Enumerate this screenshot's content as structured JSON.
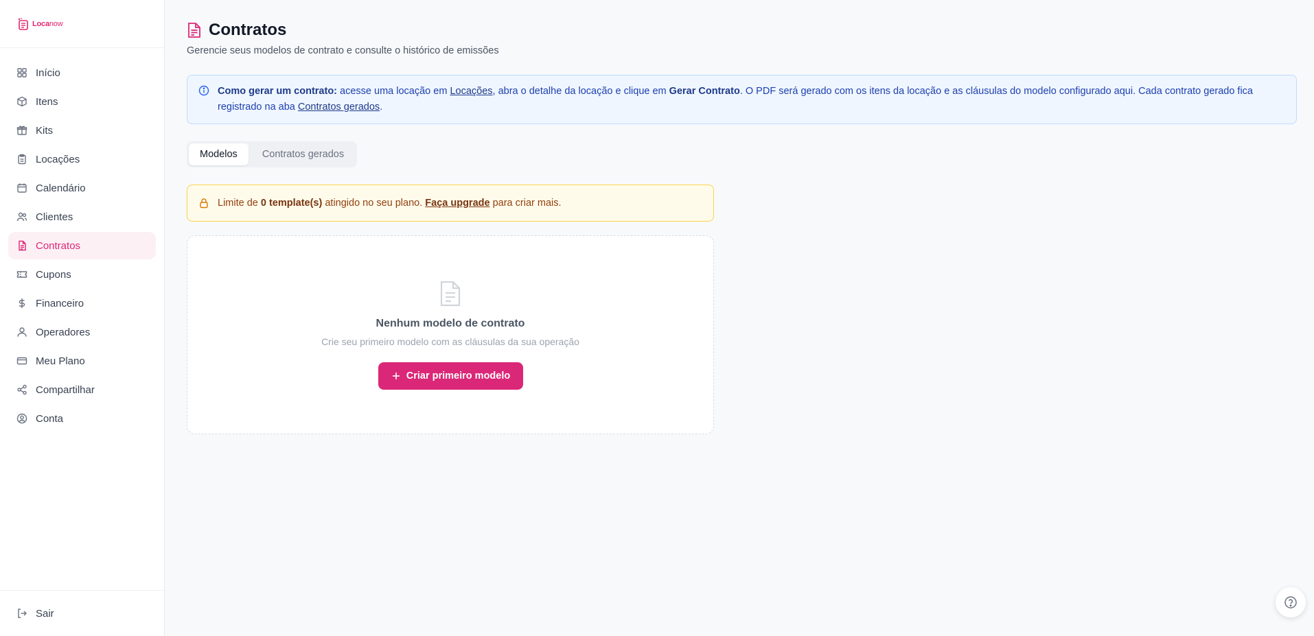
{
  "brand": {
    "name_part1": "Loca",
    "name_part2": "now"
  },
  "sidebar": {
    "items": [
      {
        "label": "Início",
        "icon": "dashboard-icon"
      },
      {
        "label": "Itens",
        "icon": "box-icon"
      },
      {
        "label": "Kits",
        "icon": "gift-icon"
      },
      {
        "label": "Locações",
        "icon": "clipboard-icon"
      },
      {
        "label": "Calendário",
        "icon": "calendar-icon"
      },
      {
        "label": "Clientes",
        "icon": "users-icon"
      },
      {
        "label": "Contratos",
        "icon": "file-text-icon",
        "active": true
      },
      {
        "label": "Cupons",
        "icon": "ticket-icon"
      },
      {
        "label": "Financeiro",
        "icon": "dollar-icon"
      },
      {
        "label": "Operadores",
        "icon": "user-icon"
      },
      {
        "label": "Meu Plano",
        "icon": "credit-card-icon"
      },
      {
        "label": "Compartilhar",
        "icon": "share-icon"
      },
      {
        "label": "Conta",
        "icon": "user-circle-icon"
      }
    ],
    "logout_label": "Sair"
  },
  "header": {
    "title": "Contratos",
    "subtitle": "Gerencie seus modelos de contrato e consulte o histórico de emissões"
  },
  "info": {
    "bold_lead": "Como gerar um contrato:",
    "text1": " acesse uma locação em ",
    "link1": "Locações",
    "text2": ", abra o detalhe da locação e clique em ",
    "bold2": "Gerar Contrato",
    "text3": ". O PDF será gerado com os itens da locação e as cláusulas do modelo configurado aqui. Cada contrato gerado fica registrado na aba ",
    "link2": "Contratos gerados",
    "text4": "."
  },
  "tabs": [
    {
      "label": "Modelos",
      "active": true
    },
    {
      "label": "Contratos gerados",
      "active": false
    }
  ],
  "warning": {
    "text1": "Limite de ",
    "bold": "0 template(s)",
    "text2": " atingido no seu plano. ",
    "link": "Faça upgrade",
    "text3": " para criar mais."
  },
  "empty_state": {
    "title": "Nenhum modelo de contrato",
    "subtitle": "Crie seu primeiro modelo com as cláusulas da sua operação",
    "button_label": "Criar primeiro modelo"
  },
  "colors": {
    "accent": "#db2777",
    "info_bg": "#eff6ff",
    "warn_bg": "#fffbeb"
  }
}
